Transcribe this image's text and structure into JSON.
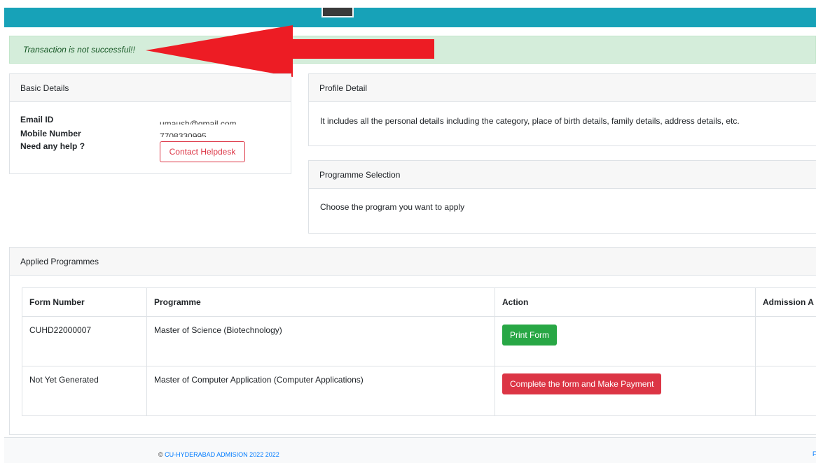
{
  "alert": {
    "message": "Transaction is not successful!!"
  },
  "basic_details": {
    "title": "Basic Details",
    "email_label": "Email ID",
    "email_value": "umaush@gmail.com",
    "mobile_label": "Mobile Number",
    "mobile_value": "7708330995",
    "help_label": "Need any help ?",
    "help_button": "Contact Helpdesk"
  },
  "profile_detail": {
    "title": "Profile Detail",
    "text": "It includes all the personal details including the category, place of birth details, family details, address details, etc."
  },
  "programme_selection": {
    "title": "Programme Selection",
    "text": "Choose the program you want to apply"
  },
  "applied_programmes": {
    "title": "Applied Programmes",
    "columns": [
      "Form Number",
      "Programme",
      "Action",
      "Admission A"
    ],
    "rows": [
      {
        "form_number": "CUHD22000007",
        "programme": "Master of Science (Biotechnology)",
        "action": "Print Form",
        "admission": ""
      },
      {
        "form_number": "Not Yet Generated",
        "programme": "Master of Computer Application (Computer Applications)",
        "action": "Complete the form and Make Payment",
        "admission": ""
      }
    ]
  },
  "footer": {
    "copyright": "©",
    "link_text": "CU-HYDERABAD ADMISION 2022 2022",
    "right_text": "F"
  },
  "colors": {
    "topbar": "#17a2b8",
    "alert_bg": "#d4edda",
    "arrow": "#ed1c24",
    "green": "#28a745",
    "red": "#dc3545"
  }
}
